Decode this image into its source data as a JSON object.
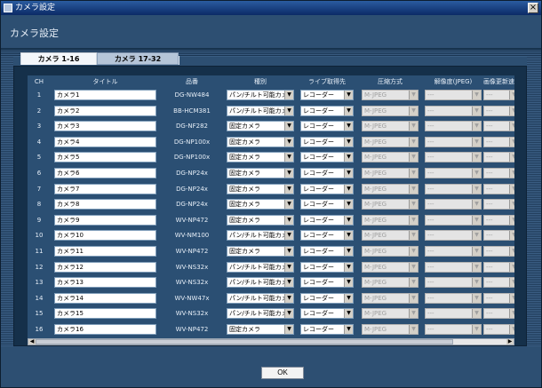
{
  "window": {
    "title": "カメラ設定"
  },
  "header": {
    "title": "カメラ設定"
  },
  "tabs": [
    {
      "label": "カメラ 1-16",
      "active": true
    },
    {
      "label": "カメラ 17-32",
      "active": false
    }
  ],
  "columns": [
    "CH",
    "タイトル",
    "品番",
    "種別",
    "ライブ取得先",
    "圧縮方式",
    "解像度(JPEG)",
    "画像更新速"
  ],
  "rows": [
    {
      "ch": "1",
      "title": "カメラ1",
      "model": "DG-NW484",
      "type": "パン/チルト可能カメラ",
      "live": "レコーダー",
      "compression": "M-JPEG",
      "resolution": "---",
      "rate": "---"
    },
    {
      "ch": "2",
      "title": "カメラ2",
      "model": "BB-HCM381",
      "type": "パン/チルト可能カメラ",
      "live": "レコーダー",
      "compression": "M-JPEG",
      "resolution": "---",
      "rate": "---"
    },
    {
      "ch": "3",
      "title": "カメラ3",
      "model": "DG-NF282",
      "type": "固定カメラ",
      "live": "レコーダー",
      "compression": "M-JPEG",
      "resolution": "---",
      "rate": "---"
    },
    {
      "ch": "4",
      "title": "カメラ4",
      "model": "DG-NP100x",
      "type": "固定カメラ",
      "live": "レコーダー",
      "compression": "M-JPEG",
      "resolution": "---",
      "rate": "---"
    },
    {
      "ch": "5",
      "title": "カメラ5",
      "model": "DG-NP100x",
      "type": "固定カメラ",
      "live": "レコーダー",
      "compression": "M-JPEG",
      "resolution": "---",
      "rate": "---"
    },
    {
      "ch": "6",
      "title": "カメラ6",
      "model": "DG-NP24x",
      "type": "固定カメラ",
      "live": "レコーダー",
      "compression": "M-JPEG",
      "resolution": "---",
      "rate": "---"
    },
    {
      "ch": "7",
      "title": "カメラ7",
      "model": "DG-NP24x",
      "type": "固定カメラ",
      "live": "レコーダー",
      "compression": "M-JPEG",
      "resolution": "---",
      "rate": "---"
    },
    {
      "ch": "8",
      "title": "カメラ8",
      "model": "DG-NP24x",
      "type": "固定カメラ",
      "live": "レコーダー",
      "compression": "M-JPEG",
      "resolution": "---",
      "rate": "---"
    },
    {
      "ch": "9",
      "title": "カメラ9",
      "model": "WV-NP472",
      "type": "固定カメラ",
      "live": "レコーダー",
      "compression": "M-JPEG",
      "resolution": "---",
      "rate": "---"
    },
    {
      "ch": "10",
      "title": "カメラ10",
      "model": "WV-NM100",
      "type": "パン/チルト可能カメラ",
      "live": "レコーダー",
      "compression": "M-JPEG",
      "resolution": "---",
      "rate": "---"
    },
    {
      "ch": "11",
      "title": "カメラ11",
      "model": "WV-NP472",
      "type": "固定カメラ",
      "live": "レコーダー",
      "compression": "M-JPEG",
      "resolution": "---",
      "rate": "---"
    },
    {
      "ch": "12",
      "title": "カメラ12",
      "model": "WV-NS32x",
      "type": "パン/チルト可能カメラ",
      "live": "レコーダー",
      "compression": "M-JPEG",
      "resolution": "---",
      "rate": "---"
    },
    {
      "ch": "13",
      "title": "カメラ13",
      "model": "WV-NS32x",
      "type": "パン/チルト可能カメラ",
      "live": "レコーダー",
      "compression": "M-JPEG",
      "resolution": "---",
      "rate": "---"
    },
    {
      "ch": "14",
      "title": "カメラ14",
      "model": "WV-NW47x",
      "type": "パン/チルト可能カメラ",
      "live": "レコーダー",
      "compression": "M-JPEG",
      "resolution": "---",
      "rate": "---"
    },
    {
      "ch": "15",
      "title": "カメラ15",
      "model": "WV-NS32x",
      "type": "パン/チルト可能カメラ",
      "live": "レコーダー",
      "compression": "M-JPEG",
      "resolution": "---",
      "rate": "---"
    },
    {
      "ch": "16",
      "title": "カメラ16",
      "model": "WV-NP472",
      "type": "固定カメラ",
      "live": "レコーダー",
      "compression": "M-JPEG",
      "resolution": "---",
      "rate": "---"
    }
  ],
  "ok_label": "OK"
}
